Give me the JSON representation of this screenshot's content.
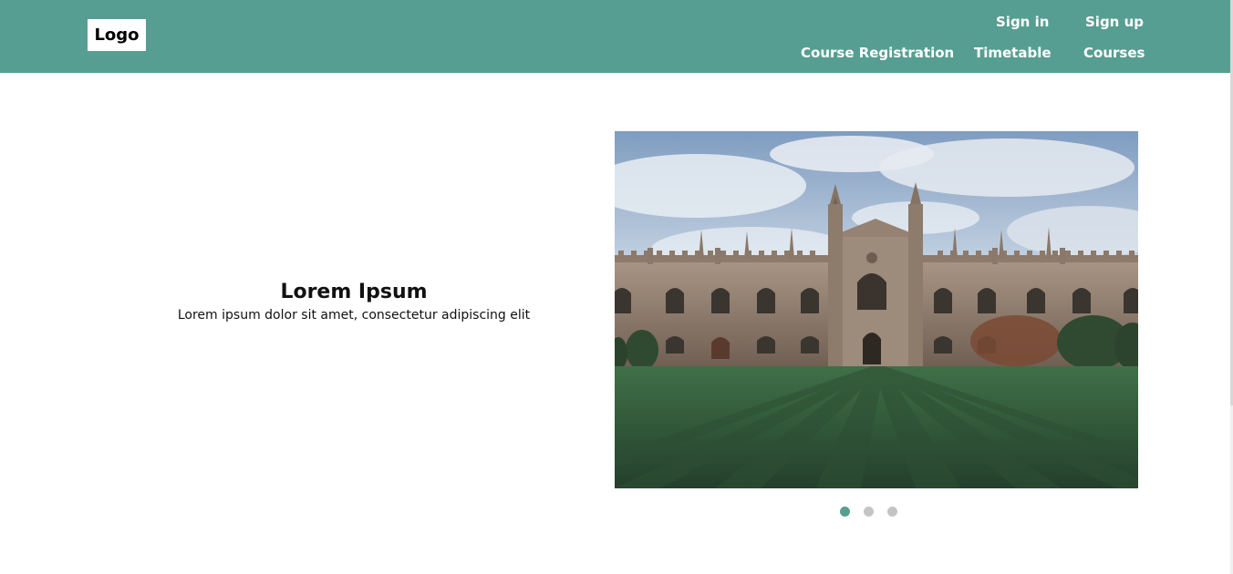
{
  "header": {
    "logo_label": "Logo",
    "top_links": [
      "Sign in",
      "Sign up"
    ],
    "main_links": [
      "Course Registration",
      "Timetable",
      "Courses"
    ],
    "background_color": "#579e92"
  },
  "hero": {
    "title": "Lorem Ipsum",
    "subtitle": "Lorem ipsum dolor sit amet, consectetur adipiscing elit"
  },
  "carousel": {
    "slide_count": 3,
    "active_index": 0,
    "active_dot_color": "#579e92",
    "inactive_dot_color": "#c4c4c4"
  }
}
